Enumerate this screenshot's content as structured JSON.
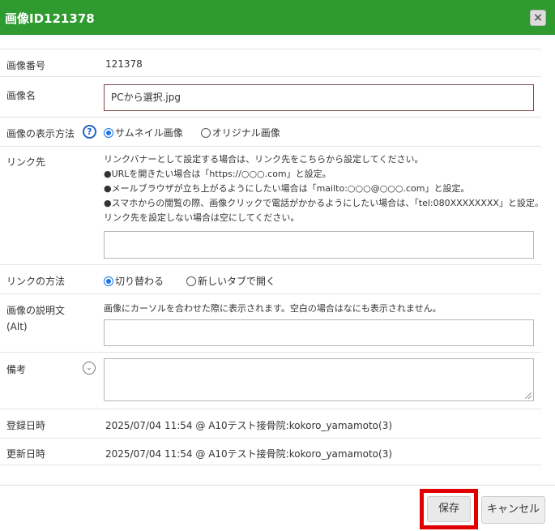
{
  "dialog": {
    "title": "画像ID121378",
    "close_label": "×"
  },
  "fields": {
    "image_number": {
      "label": "画像番号",
      "value": "121378"
    },
    "image_name": {
      "label": "画像名",
      "value": "PCから選択.jpg"
    },
    "display_method": {
      "label": "画像の表示方法",
      "help_label": "?",
      "options": [
        "サムネイル画像",
        "オリジナル画像"
      ],
      "selected": "サムネイル画像"
    },
    "link": {
      "label": "リンク先",
      "help_lines": [
        "リンクバナーとして設定する場合は、リンク先をこちらから設定してください。",
        "●URLを開きたい場合は「https://○○○.com」と設定。",
        "●メールブラウザが立ち上がるようにしたい場合は「mailto:○○○@○○○.com」と設定。",
        "●スマホからの閲覧の際、画像クリックで電話がかかるようにしたい場合は、「tel:080XXXXXXXX」と設定。",
        "リンク先を設定しない場合は空にしてください。"
      ],
      "value": ""
    },
    "link_method": {
      "label": "リンクの方法",
      "options": [
        "切り替わる",
        "新しいタブで開く"
      ],
      "selected": "切り替わる"
    },
    "alt_text": {
      "label": "画像の説明文",
      "label_sub": "(Alt)",
      "help": "画像にカーソルを合わせた際に表示されます。空白の場合はなにも表示されません。",
      "value": ""
    },
    "note": {
      "label": "備考",
      "expand_label": "⌄",
      "value": ""
    },
    "created": {
      "label": "登録日時",
      "value": "2025/07/04 11:54 @ A10テスト接骨院:kokoro_yamamoto(3)"
    },
    "updated": {
      "label": "更新日時",
      "value": "2025/07/04 11:54 @ A10テスト接骨院:kokoro_yamamoto(3)"
    }
  },
  "buttons": {
    "save": "保存",
    "cancel": "キャンセル"
  },
  "colors": {
    "titlebar": "#2f9a30",
    "highlight": "#e00000",
    "radio_selected": "#1a73e8"
  }
}
